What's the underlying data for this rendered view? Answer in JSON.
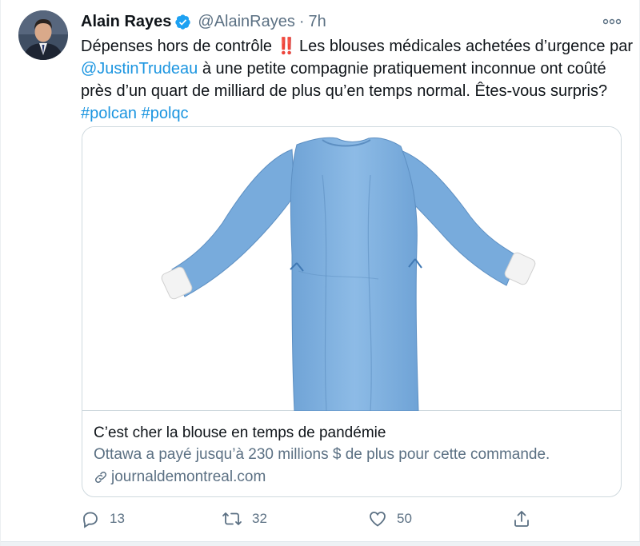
{
  "tweet": {
    "author_name": "Alain Rayes",
    "handle": "@AlainRayes",
    "separator": "·",
    "time": "7h",
    "text": {
      "part1": "Dépenses hors de contrôle ",
      "emoji": "‼️",
      "part2": " Les blouses médicales achetées d’urgence par ",
      "mention": "@JustinTrudeau",
      "part3": " à une petite compagnie pratiquement inconnue ont coûté près d’un quart de milliard de plus qu’en temps normal. Êtes-vous surpris? ",
      "hashtag1": "#polcan",
      "space": " ",
      "hashtag2": "#polqc"
    }
  },
  "card": {
    "title": "C’est cher la blouse en temps de pandémie",
    "description": "Ottawa a payé jusqu’à 230 millions $ de plus pour cette commande.",
    "domain": "journaldemontreal.com"
  },
  "actions": {
    "replies": "13",
    "retweets": "32",
    "likes": "50"
  },
  "colors": {
    "link": "#1b95e0",
    "muted": "#5b7083",
    "gown": "#7fb0de",
    "verified": "#1da1f2"
  },
  "icons": [
    "verified-badge-icon",
    "more-options-icon",
    "link-icon",
    "reply-icon",
    "retweet-icon",
    "like-icon",
    "share-icon"
  ]
}
